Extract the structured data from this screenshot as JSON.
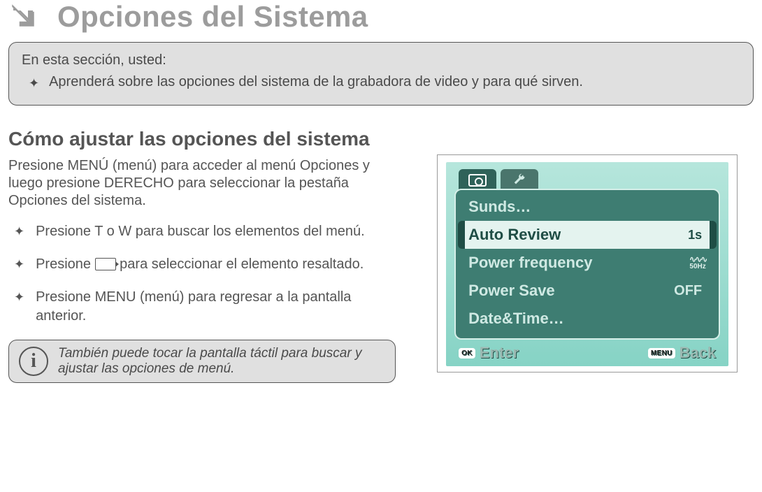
{
  "title": "Opciones del Sistema",
  "intro": {
    "lead": "En esta sección, usted:",
    "items": [
      "Aprenderá sobre las opciones del sistema de la grabadora de video y para qué sirven."
    ]
  },
  "section_heading": "Cómo ajustar las opciones del sistema",
  "lead_para": "Presione MENÚ (menú) para acceder al menú Opciones y luego presione DERECHO para seleccionar la pestaña Opciones del sistema.",
  "steps": {
    "s1": "Presione T o W para buscar los elementos del menú.",
    "s2a": "Presione",
    "s2b": "para seleccionar el elemento resaltado.",
    "s3": "Presione MENU (menú) para regresar a la pantalla anterior."
  },
  "tip": "También puede tocar la pantalla táctil para buscar y ajustar las opciones de menú.",
  "lcd": {
    "rows": {
      "r1": {
        "label": "Sunds…",
        "value": ""
      },
      "r2": {
        "label": "Auto Review",
        "value": "1s"
      },
      "r3": {
        "label": "Power frequency",
        "value": "50Hz"
      },
      "r4": {
        "label": "Power Save",
        "value": "OFF"
      },
      "r5": {
        "label": "Date&Time…",
        "value": ""
      }
    },
    "footer": {
      "ok_pill": "OK",
      "enter": "Enter",
      "menu_pill": "MENU",
      "back": "Back"
    }
  }
}
